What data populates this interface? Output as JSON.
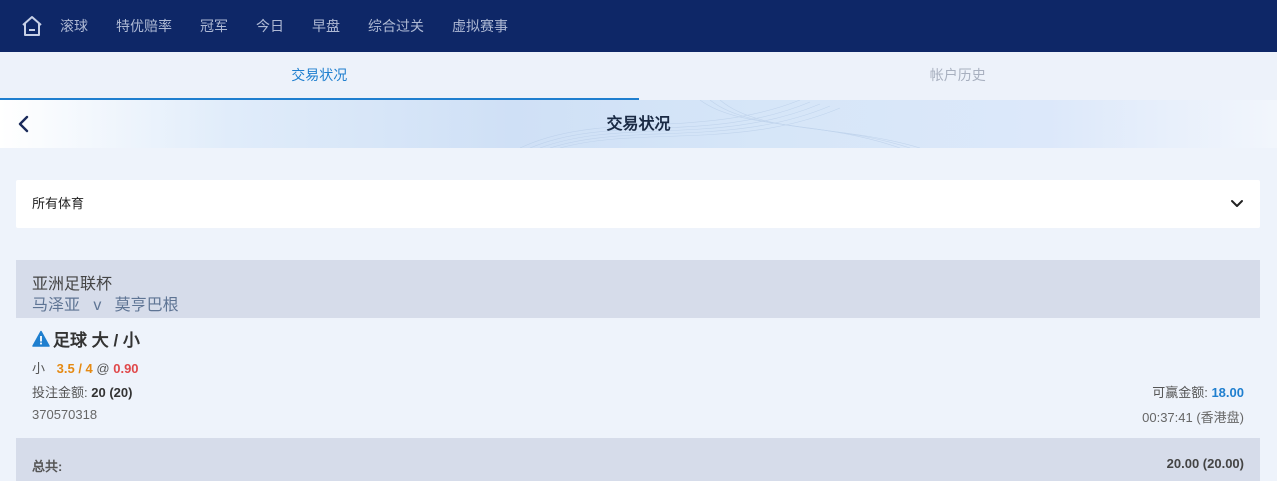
{
  "nav": {
    "home_icon": "home-icon",
    "items": [
      "滚球",
      "特优赔率",
      "冠军",
      "今日",
      "早盘",
      "综合过关",
      "虚拟赛事"
    ]
  },
  "tabs": [
    {
      "label": "交易状况",
      "active": true
    },
    {
      "label": "帐户历史",
      "active": false
    }
  ],
  "subheader": {
    "title": "交易状况",
    "back_icon": "chevron-left-icon"
  },
  "filter": {
    "selected": "所有体育",
    "icon": "chevron-down-icon"
  },
  "league": {
    "name": "亚洲足联杯",
    "match": "马泽亚   v   莫亨巴根"
  },
  "bet": {
    "title": "足球 大 / 小",
    "warning_icon": "warning-icon",
    "selection": "小",
    "handicap": "3.5 / 4",
    "at": "@",
    "odds": "0.90",
    "stake_label": "投注金额:",
    "stake_value": "20 (20)",
    "win_label": "可赢金额:",
    "win_value": "18.00",
    "ticket_id": "370570318",
    "time": "00:37:41 (香港盘)"
  },
  "total": {
    "label": "总共:",
    "value": "20.00 (20.00)"
  },
  "colors": {
    "nav_bg": "#0e2767",
    "accent": "#1f7fcf",
    "handicap": "#e58a13",
    "odds": "#e0484a",
    "section_bg": "#d6dcea"
  }
}
